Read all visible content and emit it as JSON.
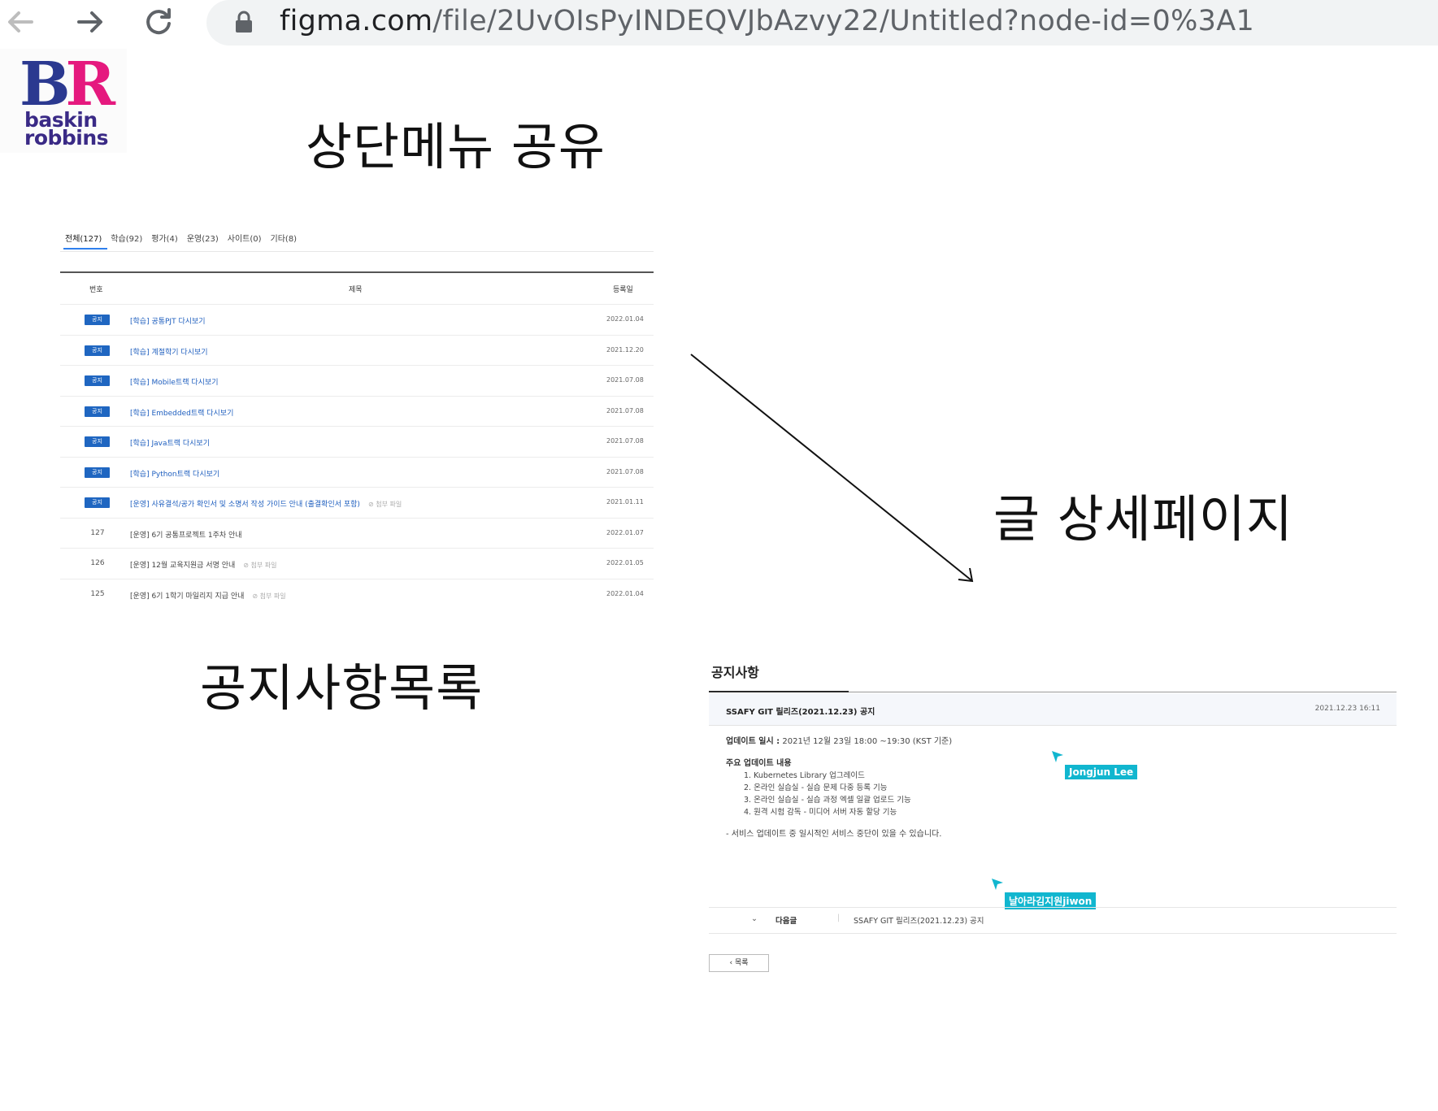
{
  "browser": {
    "url_main": "figma.com",
    "url_path": "/file/2UvOIsPyINDEQVJbAzvy22/Untitled?node-id=0%3A1"
  },
  "logo": {
    "monogram_b": "B",
    "monogram_r": "R",
    "word_1": "baskin",
    "word_2": "robbins"
  },
  "labels": {
    "top_menu_share": "상단메뉴 공유",
    "notice_list": "공지사항목록",
    "post_detail": "글 상세페이지"
  },
  "notice_list": {
    "tabs": [
      "전체(127)",
      "학습(92)",
      "평가(4)",
      "운영(23)",
      "사이트(0)",
      "기타(8)"
    ],
    "headers": {
      "number": "번호",
      "title": "제목",
      "date": "등록일"
    },
    "badge_label": "공지",
    "attachment_label": "첨부 파일",
    "rows": [
      {
        "num": "",
        "notice": true,
        "title": "[학습] 공통PJT 다시보기",
        "date": "2022.01.04",
        "attach": ""
      },
      {
        "num": "",
        "notice": true,
        "title": "[학습] 계절학기 다시보기",
        "date": "2021.12.20",
        "attach": ""
      },
      {
        "num": "",
        "notice": true,
        "title": "[학습] Mobile트랙 다시보기",
        "date": "2021.07.08",
        "attach": ""
      },
      {
        "num": "",
        "notice": true,
        "title": "[학습] Embedded트랙 다시보기",
        "date": "2021.07.08",
        "attach": ""
      },
      {
        "num": "",
        "notice": true,
        "title": "[학습] Java트랙 다시보기",
        "date": "2021.07.08",
        "attach": ""
      },
      {
        "num": "",
        "notice": true,
        "title": "[학습] Python트랙 다시보기",
        "date": "2021.07.08",
        "attach": ""
      },
      {
        "num": "",
        "notice": true,
        "title": "[운영] 사유결석/공가 확인서 및 소명서 작성 가이드 안내 (출결확인서 포함)",
        "date": "2021.01.11",
        "attach": "첨부 파일"
      },
      {
        "num": "127",
        "notice": false,
        "title": "[운영] 6기 공통프로젝트 1주차 안내",
        "date": "2022.01.07",
        "attach": ""
      },
      {
        "num": "126",
        "notice": false,
        "title": "[운영] 12월 교육지원금 서명 안내",
        "date": "2022.01.05",
        "attach": "첨부 파일"
      },
      {
        "num": "125",
        "notice": false,
        "title": "[운영] 6기 1학기 마일리지 지급 안내",
        "date": "2022.01.04",
        "attach": "첨부 파일"
      }
    ]
  },
  "detail": {
    "heading": "공지사항",
    "post_title": "SSAFY GIT 릴리즈(2021.12.23) 공지",
    "post_date": "2021.12.23 16:11",
    "update_time_label": "업데이트 일시 :",
    "update_time_value": "2021년 12월 23일 18:00 ~19:30 (KST 기준)",
    "main_updates_label": "주요 업데이트 내용",
    "items": [
      "1. Kubernetes Library 업그레이드",
      "2. 온라인 실습실 - 실습 문제 다중 등록 기능",
      "3. 온라인 실습실 - 실습 과정 엑셀 일괄 업로드 기능",
      "4. 원격 시험 감독 - 미디어 서버 자동 할당 기능"
    ],
    "notice_line": "- 서비스 업데이트 중 일시적인 서비스 중단이 있을 수 있습니다.",
    "next_label": "다음글",
    "next_title": "SSAFY GIT 릴리즈(2021.12.23) 공지",
    "list_button": "목록"
  },
  "collaborators": [
    {
      "name": "Jongjun Lee",
      "color": "#11b6cf"
    },
    {
      "name": "날아라김지원jiwon",
      "color": "#11b6cf"
    }
  ]
}
